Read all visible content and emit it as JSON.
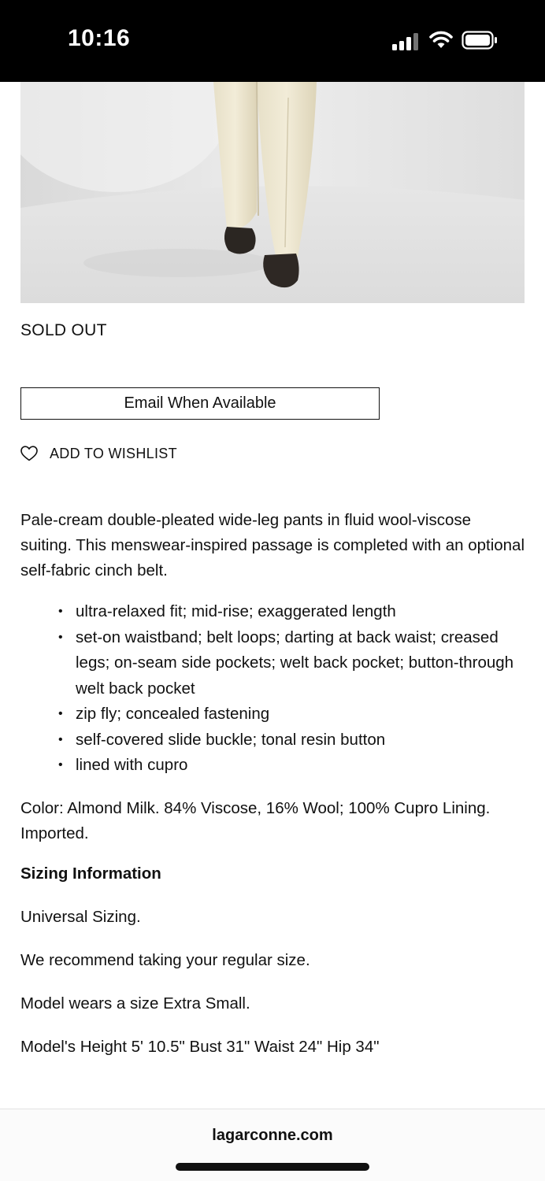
{
  "status_bar": {
    "time": "10:16",
    "icons": [
      "signal-icon",
      "wifi-icon",
      "battery-icon"
    ]
  },
  "product": {
    "image": "product-photo-cream-pants",
    "availability": "SOLD OUT",
    "email_button_label": "Email When Available",
    "wishlist_label": "ADD TO WISHLIST",
    "description": "Pale-cream double-pleated wide-leg pants in fluid wool-viscose suiting. This menswear-inspired passage is completed with an optional self-fabric cinch belt.",
    "features": [
      "ultra-relaxed fit; mid-rise; exaggerated length",
      "set-on waistband; belt loops; darting at back waist; creased legs; on-seam side pockets; welt back pocket; button-through welt back pocket",
      "zip fly; concealed fastening",
      "self-covered slide buckle; tonal resin button",
      "lined with cupro"
    ],
    "composition": "Color: Almond Milk. 84% Viscose, 16% Wool; 100% Cupro Lining. Imported."
  },
  "sizing": {
    "title": "Sizing Information",
    "lines": [
      "Universal Sizing.",
      "We recommend taking your regular size.",
      "Model wears a size Extra Small.",
      "Model's Height 5' 10.5\" Bust 31\" Waist 24\" Hip 34\""
    ]
  },
  "browser": {
    "url": "lagarconne.com"
  },
  "colors": {
    "status_bar": "#000000",
    "text": "#111111",
    "background": "#ffffff"
  }
}
